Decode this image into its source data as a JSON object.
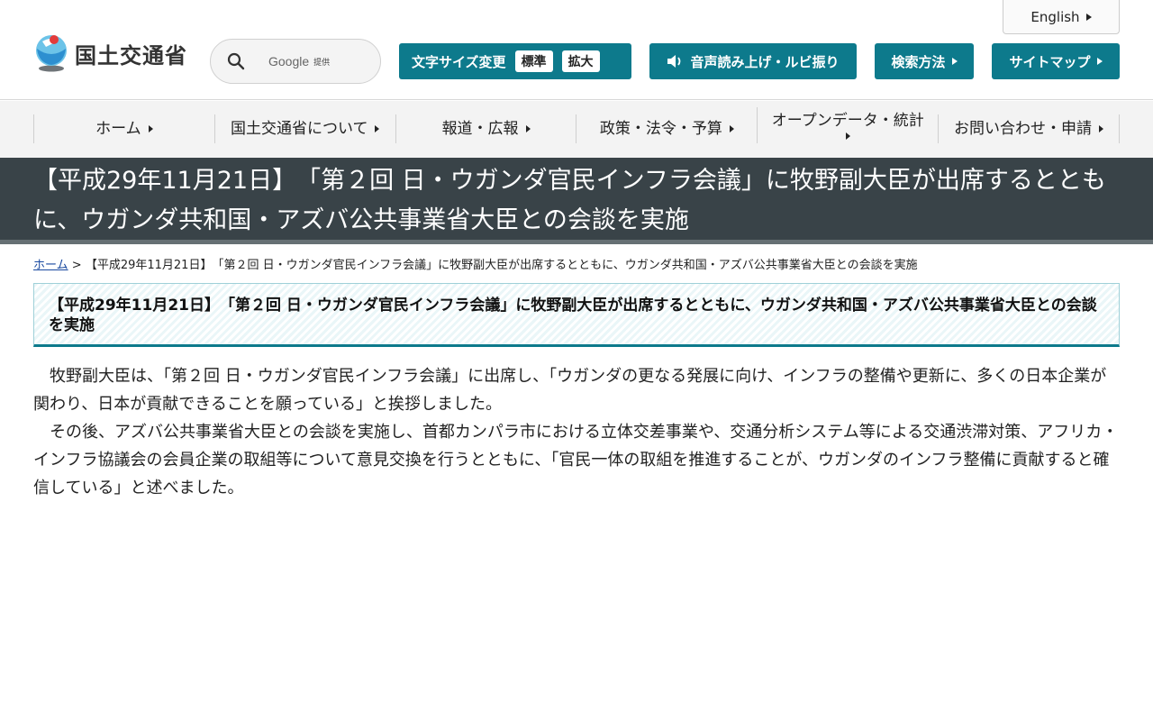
{
  "header": {
    "logo_text": "国土交通省",
    "search": {
      "google": "Google",
      "provided": "提供"
    },
    "english": "English",
    "font_size": {
      "label": "文字サイズ変更",
      "standard": "標準",
      "large": "拡大"
    },
    "voice": "音声読み上げ・ルビ振り",
    "howto": "検索方法",
    "sitemap": "サイトマップ"
  },
  "nav": [
    {
      "label": "ホーム"
    },
    {
      "label": "国土交通省について"
    },
    {
      "label": "報道・広報"
    },
    {
      "label": "政策・法令・予算"
    },
    {
      "label": "オープンデータ・統計"
    },
    {
      "label": "お問い合わせ・申請"
    }
  ],
  "page_title": "【平成29年11月21日】　「第２回 日・ウガンダ官民インフラ会議」に牧野副大臣が出席するとともに、ウガンダ共和国・アズバ公共事業省大臣との会談を実施",
  "breadcrumb": {
    "home": "ホーム",
    "sep": ">",
    "current": "【平成29年11月21日】　「第２回 日・ウガンダ官民インフラ会議」に牧野副大臣が出席するとともに、ウガンダ共和国・アズバ公共事業省大臣との会談を実施"
  },
  "heading": "【平成29年11月21日】　「第２回 日・ウガンダ官民インフラ会議」に牧野副大臣が出席するとともに、ウガンダ共和国・アズバ公共事業省大臣との会談を実施",
  "body": [
    "牧野副大臣は、「第２回 日・ウガンダ官民インフラ会議」に出席し、「ウガンダの更なる発展に向け、インフラの整備や更新に、多くの日本企業が関わり、日本が貢献できることを願っている」と挨拶しました。",
    "その後、アズバ公共事業省大臣との会談を実施し、首都カンパラ市における立体交差事業や、交通分析システム等による交通渋滞対策、アフリカ・インフラ協議会の会員企業の取組等について意見交換を行うとともに、「官民一体の取組を推進することが、ウガンダのインフラ整備に貢献すると確信している」と述べました。"
  ],
  "colors": {
    "accent": "#0d7a8c",
    "title_band": "#394348"
  }
}
